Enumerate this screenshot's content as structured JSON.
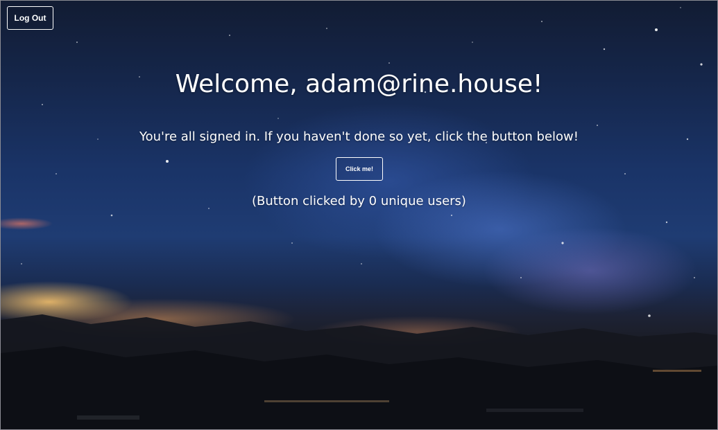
{
  "header": {
    "logout_label": "Log Out"
  },
  "main": {
    "welcome_title": "Welcome, adam@rine.house!",
    "signed_in_text": "You're all signed in. If you haven't done so yet, click the button below!",
    "click_button_label": "Click me!",
    "click_count_text": "(Button clicked by 0 unique users)"
  }
}
